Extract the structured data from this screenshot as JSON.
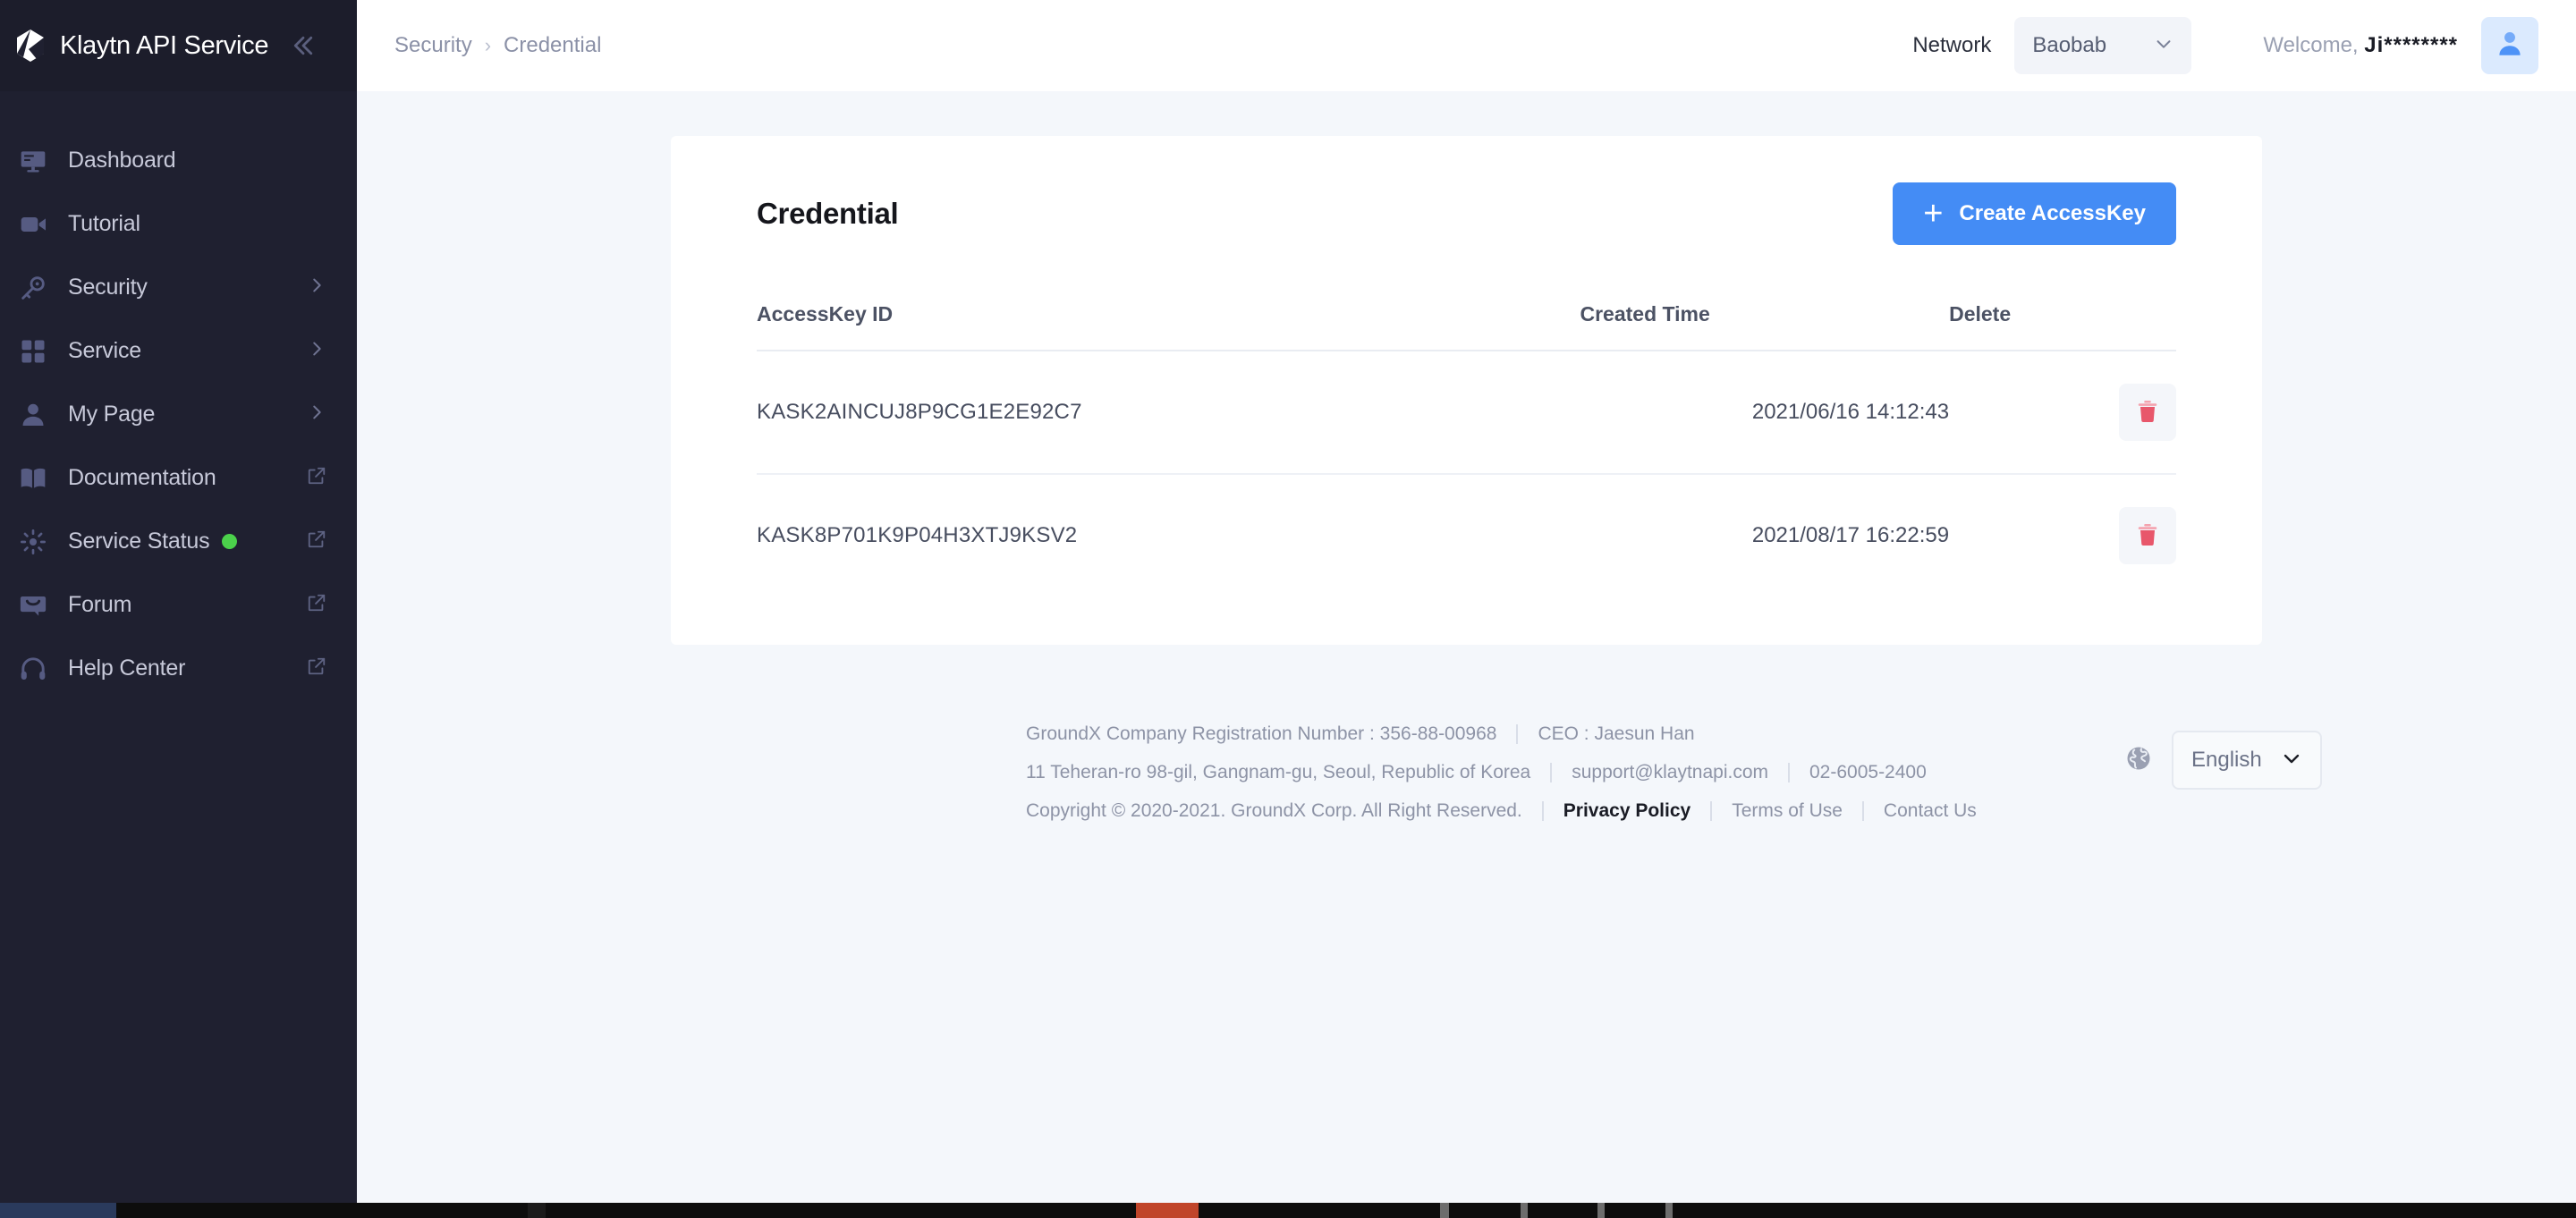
{
  "brand": {
    "title": "Klaytn API Service",
    "logo_icon": "klaytn-logo-icon",
    "collapse_icon": "double-chevron-left-icon"
  },
  "sidebar": {
    "items": [
      {
        "label": "Dashboard",
        "icon": "monitor-icon",
        "trailing": "none"
      },
      {
        "label": "Tutorial",
        "icon": "video-camera-icon",
        "trailing": "none"
      },
      {
        "label": "Security",
        "icon": "key-icon",
        "trailing": "chevron"
      },
      {
        "label": "Service",
        "icon": "grid-icon",
        "trailing": "chevron"
      },
      {
        "label": "My Page",
        "icon": "person-icon",
        "trailing": "chevron"
      },
      {
        "label": "Documentation",
        "icon": "book-icon",
        "trailing": "external"
      },
      {
        "label": "Service Status",
        "icon": "sun-icon",
        "trailing": "external",
        "status": "online"
      },
      {
        "label": "Forum",
        "icon": "chat-bubble-icon",
        "trailing": "external"
      },
      {
        "label": "Help Center",
        "icon": "headset-icon",
        "trailing": "external"
      }
    ]
  },
  "topbar": {
    "breadcrumb": [
      "Security",
      "Credential"
    ],
    "breadcrumb_separator": "›",
    "network_label": "Network",
    "network_value": "Baobab",
    "network_chevron_icon": "chevron-down-icon",
    "welcome_prefix": "Welcome, ",
    "welcome_user": "Ji********",
    "avatar_icon": "user-avatar-icon"
  },
  "card": {
    "title": "Credential",
    "create_button": "Create AccessKey",
    "create_button_icon": "plus-icon",
    "columns": [
      "AccessKey ID",
      "Created Time",
      "Delete"
    ],
    "rows": [
      {
        "access_key_id": "KASK2AINCUJ8P9CG1E2E92C7",
        "created_time": "2021/06/16 14:12:43",
        "delete_icon": "trash-icon"
      },
      {
        "access_key_id": "KASK8P701K9P04H3XTJ9KSV2",
        "created_time": "2021/08/17 16:22:59",
        "delete_icon": "trash-icon"
      }
    ]
  },
  "footer": {
    "line1_a": "GroundX Company Registration Number : 356-88-00968",
    "line1_b": "CEO : Jaesun Han",
    "line2_a": "11 Teheran-ro 98-gil, Gangnam-gu, Seoul, Republic of Korea",
    "line2_b": "support@klaytnapi.com",
    "line2_c": "02-6005-2400",
    "line3_a": "Copyright © 2020-2021. GroundX Corp. All Right Reserved.",
    "privacy_policy": "Privacy Policy",
    "terms_of_use": "Terms of Use",
    "contact_us": "Contact Us",
    "globe_icon": "globe-icon",
    "language_value": "English",
    "language_chevron_icon": "chevron-down-icon"
  },
  "colors": {
    "sidebar_bg": "#1f2030",
    "accent_blue": "#448cf5",
    "delete_red": "#e8576b",
    "status_green": "#4bd14b",
    "page_bg": "#f4f7fb"
  }
}
